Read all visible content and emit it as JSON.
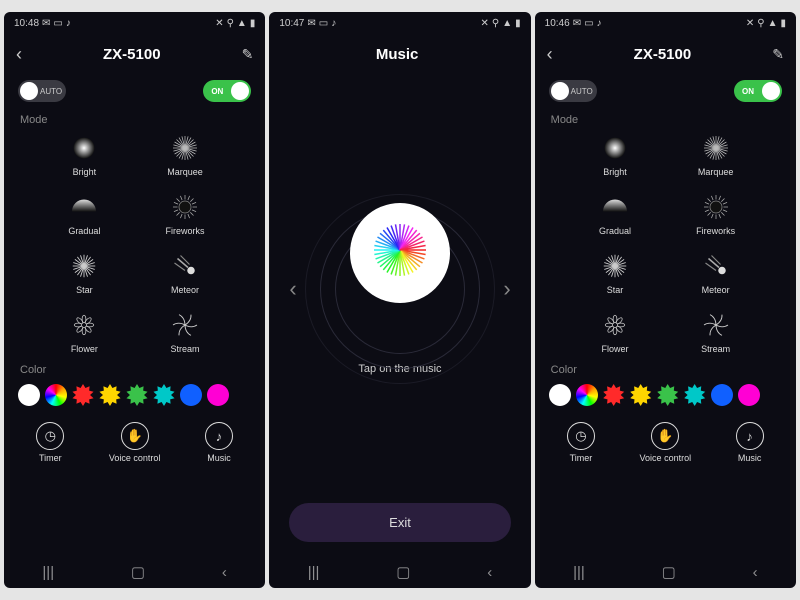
{
  "screens": [
    {
      "time": "10:48",
      "title": "ZX-5100",
      "type": "control"
    },
    {
      "time": "10:47",
      "title": "Music",
      "type": "music"
    },
    {
      "time": "10:46",
      "title": "ZX-5100",
      "type": "control"
    }
  ],
  "toggles": {
    "auto_label": "AUTO",
    "on_label": "ON"
  },
  "section_mode": "Mode",
  "section_color": "Color",
  "modes": [
    {
      "name": "Bright"
    },
    {
      "name": "Marquee"
    },
    {
      "name": "Gradual"
    },
    {
      "name": "Fireworks"
    },
    {
      "name": "Star"
    },
    {
      "name": "Meteor"
    },
    {
      "name": "Flower"
    },
    {
      "name": "Stream"
    }
  ],
  "colors": [
    "#ffffff",
    "rainbow",
    "#ff2a2a",
    "#ffd500",
    "#3ac24a",
    "#00c8c8",
    "#1060ff",
    "#ff00d4"
  ],
  "actions": [
    {
      "name": "Timer",
      "icon": "timer"
    },
    {
      "name": "Voice control",
      "icon": "clap"
    },
    {
      "name": "Music",
      "icon": "note"
    }
  ],
  "music": {
    "hint": "Tap on the music",
    "exit": "Exit"
  }
}
